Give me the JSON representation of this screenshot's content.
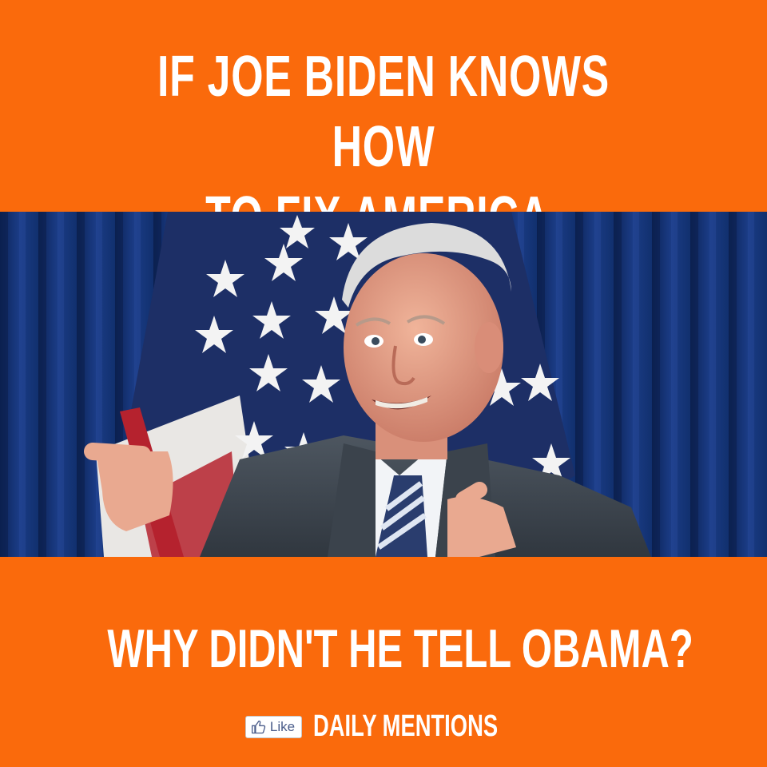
{
  "meme": {
    "top_text_line1": "IF JOE BIDEN KNOWS HOW",
    "top_text_line2": "TO FIX AMERICA,",
    "bottom_text": "WHY DIDN'T HE TELL OBAMA?"
  },
  "footer": {
    "like_label": "Like",
    "like_icon": "thumbs-up-icon",
    "brand": "DAILY MENTIONS"
  },
  "colors": {
    "background": "#fa6a0c",
    "text": "#ffffff",
    "curtain": "#14306e",
    "flag_blue": "#1d2f66",
    "flag_red": "#b5222e"
  }
}
